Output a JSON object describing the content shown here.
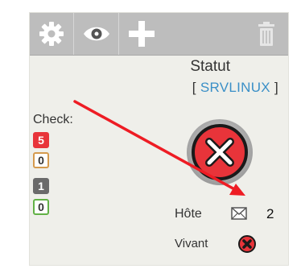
{
  "toolbar": {
    "buttons": [
      {
        "icon": "gear-icon"
      },
      {
        "icon": "eye-icon"
      },
      {
        "icon": "plus-icon"
      },
      {
        "icon": "trash-icon"
      }
    ]
  },
  "status": {
    "title": "Statut",
    "host_open": "[ ",
    "host_name": "SRVLINUX",
    "host_close": " ]"
  },
  "checks": {
    "label": "Check:",
    "counts": [
      {
        "value": "5",
        "color": "#e8343a",
        "text_color": "#ffffff"
      },
      {
        "value": "0",
        "color": "#d59a4d",
        "text_color": "#333333"
      },
      {
        "value": "1",
        "color": "#6a6a6a",
        "text_color": "#ffffff"
      },
      {
        "value": "0",
        "color": "#62b146",
        "text_color": "#333333"
      }
    ]
  },
  "big_status": {
    "icon": "critical-x-icon",
    "color": "#e8343a"
  },
  "host_row": {
    "label": "Hôte",
    "icon": "envelope-icon",
    "count": "2"
  },
  "alive_row": {
    "label": "Vivant",
    "icon": "critical-x-icon-small",
    "color": "#e8343a"
  },
  "annotation": {
    "color": "#ee1c24"
  }
}
